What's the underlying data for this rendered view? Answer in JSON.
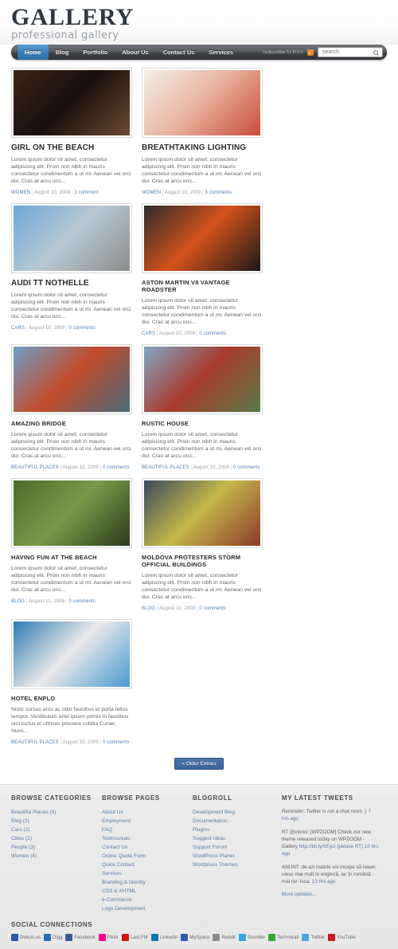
{
  "site": {
    "logo_title": "GALLERY",
    "logo_subtitle": "professional gallery"
  },
  "nav": {
    "items": [
      {
        "label": "Home",
        "active": true
      },
      {
        "label": "Blog",
        "active": false
      },
      {
        "label": "Portfolio",
        "active": false
      },
      {
        "label": "About Us",
        "active": false
      },
      {
        "label": "Contact Us",
        "active": false
      },
      {
        "label": "Services",
        "active": false
      }
    ],
    "rss_label": "Subscribe to RSS",
    "search_placeholder": "search"
  },
  "posts": [
    {
      "title": "GIRL ON THE BEACH",
      "excerpt": "Lorem ipsum dolor sit amet, consectetur adipiscing elit. Proin non nibh in mauris consectetur condimentum a ut mi. Aenean vel orci dui. Cras at arcu orci...",
      "category": "WOMEN",
      "date": "August 10, 2009",
      "comments": "1 comment",
      "image_colors": [
        "#3a2419",
        "#18100c",
        "#6b4a32"
      ],
      "title_size": "large"
    },
    {
      "title": "BREATHTAKING LIGHTING",
      "excerpt": "Lorem ipsum dolor sit amet, consectetur adipiscing elit. Proin non nibh in mauris consectetur condimentum a ut mi. Aenean vel orci dui. Cras at arcu orci...",
      "category": "WOMEN",
      "date": "August 10, 2009",
      "comments": "3 comments",
      "image_colors": [
        "#f2efe8",
        "#e8b4a0",
        "#c94b3a"
      ],
      "title_size": "large"
    },
    {
      "title": "AUDI TT NOTHELLE",
      "excerpt": "Lorem ipsum dolor sit amet, consectetur adipiscing elit. Proin non nibh in mauris consectetur condimentum a ut mi. Aenean vel orci dui. Cras at arcu orci...",
      "category": "CARS",
      "date": "August 10, 2009",
      "comments": "0 comments",
      "image_colors": [
        "#6fa8d6",
        "#b8c9d4",
        "#8a8d8a"
      ],
      "title_size": "large"
    },
    {
      "title": "ASTON MARTIN V8 VANTAGE ROADSTER",
      "excerpt": "Lorem ipsum dolor sit amet, consectetur adipiscing elit. Proin non nibh in mauris consectetur condimentum a ut mi. Aenean vel orci dui. Cras at arcu orci...",
      "category": "CARS",
      "date": "August 10, 2009",
      "comments": "0 comments",
      "image_colors": [
        "#2b2b2b",
        "#d4521a",
        "#1a1a1a"
      ],
      "title_size": "small"
    },
    {
      "title": "AMAZING BRIDGE",
      "excerpt": "Lorem ipsum dolor sit amet, consectetur adipiscing elit. Proin non nibh in mauris consectetur condimentum a ut mi. Aenean vel orci dui. Cras at arcu orci...",
      "category": "BEAUTIFUL PLACES",
      "date": "August 10, 2009",
      "comments": "0 comments",
      "image_colors": [
        "#6ca0c8",
        "#c14b2a",
        "#4a6b7a"
      ],
      "title_size": "small"
    },
    {
      "title": "RUSTIC HOUSE",
      "excerpt": "Lorem ipsum dolor sit amet, consectetur adipiscing elit. Proin non nibh in mauris consectetur condimentum a ut mi. Aenean vel orci dui. Cras at arcu orci...",
      "category": "BEAUTIFUL PLACES",
      "date": "August 10, 2009",
      "comments": "0 comments",
      "image_colors": [
        "#7fa8c4",
        "#a83a2e",
        "#5a7a4a"
      ],
      "title_size": "small"
    },
    {
      "title": "HAVING FUN AT THE BEACH",
      "excerpt": "Lorem ipsum dolor sit amet, consectetur adipiscing elit. Proin non nibh in mauris consectetur condimentum a ut mi. Aenean vel orci dui. Cras at arcu orci...",
      "category": "BLOG",
      "date": "August 10, 2009",
      "comments": "0 comments",
      "image_colors": [
        "#4a6b2a",
        "#7a9a4a",
        "#2a3a1a"
      ],
      "title_size": "small"
    },
    {
      "title": "MOLDOVA PROTESTERS STORM OFFICIAL BUILDINGS",
      "excerpt": "Lorem ipsum dolor sit amet, consectetur adipiscing elit. Proin non nibh in mauris consectetur condimentum a ut mi. Aenean vel orci dui. Cras at arcu orci...",
      "category": "BLOG",
      "date": "August 10, 2009",
      "comments": "0 comments",
      "image_colors": [
        "#3a4a5a",
        "#c4b84a",
        "#8a3a2a"
      ],
      "title_size": "small"
    },
    {
      "title": "HOTEL ENPLO",
      "excerpt": "Nunc cursus arcu ac odio faucibus et porta tellus tempor. Vestibulum ante ipsum primis in faucibus orci luctus et ultrices posuere cubilia Curae; Nunc...",
      "category": "BEAUTIFUL PLACES",
      "date": "August 10, 2009",
      "comments": "0 comments",
      "image_colors": [
        "#2d7ab5",
        "#eaeaea",
        "#4a9ad0"
      ],
      "title_size": "small"
    }
  ],
  "pagination": {
    "older_label": "« Older Entries"
  },
  "footer": {
    "categories": {
      "heading": "BROWSE CATEGORIES",
      "items": [
        "Beautiful Places (6)",
        "Blog (2)",
        "Cars (2)",
        "Cities (2)",
        "People (3)",
        "Women (4)"
      ]
    },
    "pages": {
      "heading": "BROWSE PAGES",
      "items": [
        "About Us",
        "Employment",
        "FAQ",
        "Testimonials",
        "Contact Us",
        "Online Quote Form",
        "Quick Contact",
        "Services",
        "Branding & Identity",
        "CSS & XHTML",
        "e-Commerce",
        "Logo Development"
      ]
    },
    "blogroll": {
      "heading": "BLOGROLL",
      "items": [
        "Development Blog",
        "Documentation",
        "Plugins",
        "Suggest Ideas",
        "Support Forum",
        "WordPress Planet",
        "Wordpress Themes"
      ]
    },
    "tweets": {
      "heading": "MY LATEST TWEETS",
      "items": [
        {
          "text": "Reminder: Twitter is not a chat room :)",
          "link": "",
          "time": "7 hrs ago"
        },
        {
          "text": "RT @clorici: [WPZOOM] Check our new theme released today on WPZOOM - Gallery",
          "link": "http://bit.ly/5Eyci",
          "time": "(please RT) 10 hrs ago"
        },
        {
          "text": "ANUNT: de azi inainte voi incepe să tweet-uiesc mai mult în engleză, iar în română mai rar. Isca.",
          "link": "",
          "time": "13 hrs ago"
        }
      ],
      "more_label": "More updates..."
    },
    "social": {
      "heading": "SOCIAL CONNECTIONS",
      "items": [
        {
          "label": "Delicio.us",
          "icon": "delicious-icon",
          "color": "#2b55b0"
        },
        {
          "label": "Digg",
          "icon": "digg-icon",
          "color": "#2a6fb5"
        },
        {
          "label": "Facebook",
          "icon": "facebook-icon",
          "color": "#3b5998"
        },
        {
          "label": "Flickr",
          "icon": "flickr-icon",
          "color": "#ff0084"
        },
        {
          "label": "Last.FM",
          "icon": "lastfm-icon",
          "color": "#d51007"
        },
        {
          "label": "LinkedIn",
          "icon": "linkedin-icon",
          "color": "#0e76a8"
        },
        {
          "label": "MySpace",
          "icon": "myspace-icon",
          "color": "#2a5db0"
        },
        {
          "label": "Reddit",
          "icon": "reddit-icon",
          "color": "#8a8a8a"
        },
        {
          "label": "Stumble",
          "icon": "stumbleupon-icon",
          "color": "#3aa3d8"
        },
        {
          "label": "Technorati",
          "icon": "technorati-icon",
          "color": "#3aa33a"
        },
        {
          "label": "Twitter",
          "icon": "twitter-icon",
          "color": "#4fa3d8"
        },
        {
          "label": "YouTube",
          "icon": "youtube-icon",
          "color": "#cc181e"
        }
      ]
    }
  },
  "theme": {
    "link_color": "#4e7fb5",
    "accent_blue": "#3d7fb8",
    "footer_bg": "#e8e8e8"
  }
}
